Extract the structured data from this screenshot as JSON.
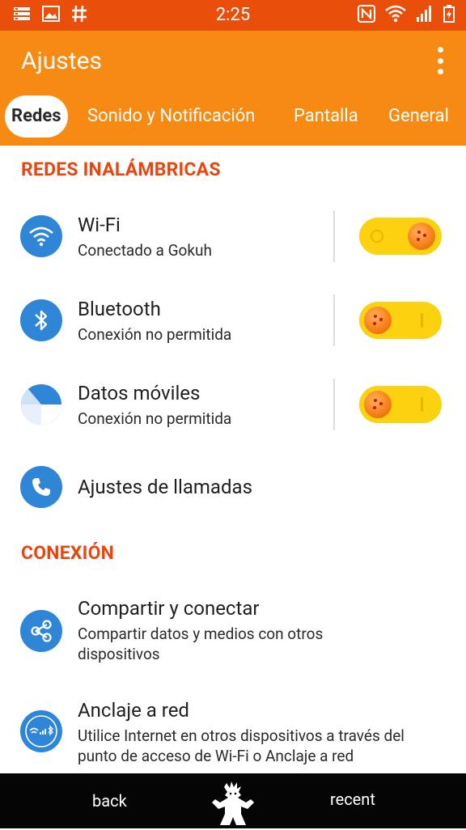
{
  "status_bar": {
    "time": "2:25",
    "left_icons": [
      "notification-list-icon",
      "gallery-icon",
      "hash-icon"
    ],
    "right_icons": [
      "nfc-icon",
      "wifi-signal-icon",
      "cell-signal-icon",
      "battery-charging-icon"
    ]
  },
  "app_bar": {
    "title": "Ajustes",
    "menu_icon": "more-vert-icon"
  },
  "tabs": [
    {
      "label": "Redes",
      "active": true
    },
    {
      "label": "Sonido y Notificación",
      "active": false
    },
    {
      "label": "Pantalla",
      "active": false
    },
    {
      "label": "General",
      "active": false
    }
  ],
  "sections": {
    "wireless": {
      "header": "REDES INALÁMBRICAS",
      "items": [
        {
          "title": "Wi-Fi",
          "subtitle": "Conectado a Gokuh",
          "icon": "wifi-icon",
          "toggle_on": true
        },
        {
          "title": "Bluetooth",
          "subtitle": "Conexión no permitida",
          "icon": "bluetooth-icon",
          "toggle_on": false
        },
        {
          "title": "Datos móviles",
          "subtitle": "Conexión no permitida",
          "icon": "mobile-data-icon",
          "toggle_on": false
        },
        {
          "title": "Ajustes de llamadas",
          "icon": "phone-icon"
        }
      ]
    },
    "connection": {
      "header": "CONEXIÓN",
      "items": [
        {
          "title": "Compartir y conectar",
          "subtitle": "Compartir datos y medios con otros dispositivos",
          "icon": "share-icon"
        },
        {
          "title": "Anclaje a red",
          "subtitle": "Utilice Internet en otros dispositivos a través del punto de acceso de Wi-Fi o Anclaje a red",
          "icon": "tethering-icon"
        }
      ]
    }
  },
  "nav_bar": {
    "back_label": "back",
    "recent_label": "recent",
    "home_icon": "home-figure-icon"
  },
  "colors": {
    "status_bar": "#ea4e0b",
    "app_bar": "#f78a12",
    "section_header": "#e8460f",
    "icon_circle": "#2f86d6",
    "toggle_track": "#fcd10f"
  }
}
